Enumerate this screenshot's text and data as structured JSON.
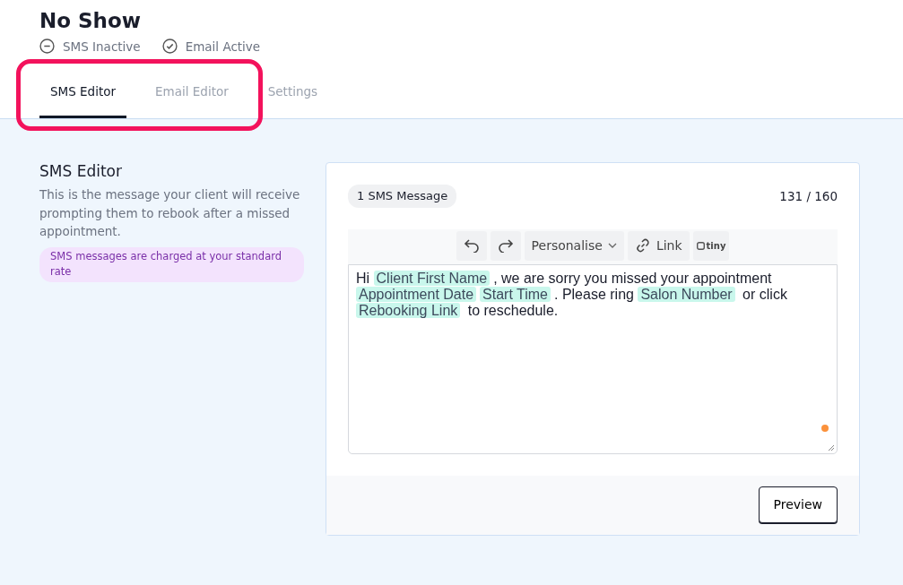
{
  "page": {
    "title": "No Show"
  },
  "statuses": [
    {
      "label": "SMS Inactive",
      "active": false
    },
    {
      "label": "Email Active",
      "active": true
    }
  ],
  "tabs": [
    {
      "label": "SMS Editor",
      "selected": true,
      "highlighted": true
    },
    {
      "label": "Email Editor",
      "selected": false,
      "highlighted": true
    },
    {
      "label": "Settings",
      "selected": false,
      "highlighted": false
    }
  ],
  "section": {
    "title": "SMS Editor",
    "description": "This is the message your client will receive prompting them to rebook after a missed appointment.",
    "notice": "SMS messages are charged at your standard rate"
  },
  "editor": {
    "message_count": "1 SMS Message",
    "char_count": "131 / 160",
    "toolbar": [
      {
        "kind": "undo"
      },
      {
        "kind": "redo"
      },
      {
        "kind": "dropdown",
        "label": "Personalise"
      },
      {
        "kind": "link",
        "label": "Link"
      },
      {
        "kind": "logo",
        "label": "tiny"
      }
    ],
    "content": [
      {
        "kind": "text",
        "text": "Hi "
      },
      {
        "kind": "tag",
        "text": "Client First Name"
      },
      {
        "kind": "text",
        "text": ", we are sorry you missed your appointment "
      },
      {
        "kind": "tag",
        "text": "Appointment Date"
      },
      {
        "kind": "tag",
        "text": "Start Time"
      },
      {
        "kind": "text",
        "text": ". Please ring "
      },
      {
        "kind": "tag",
        "text": "Salon Number"
      },
      {
        "kind": "text",
        "text": " or click "
      },
      {
        "kind": "tag",
        "text": "Rebooking Link"
      },
      {
        "kind": "text",
        "text": " to reschedule."
      }
    ],
    "button": "Preview"
  }
}
